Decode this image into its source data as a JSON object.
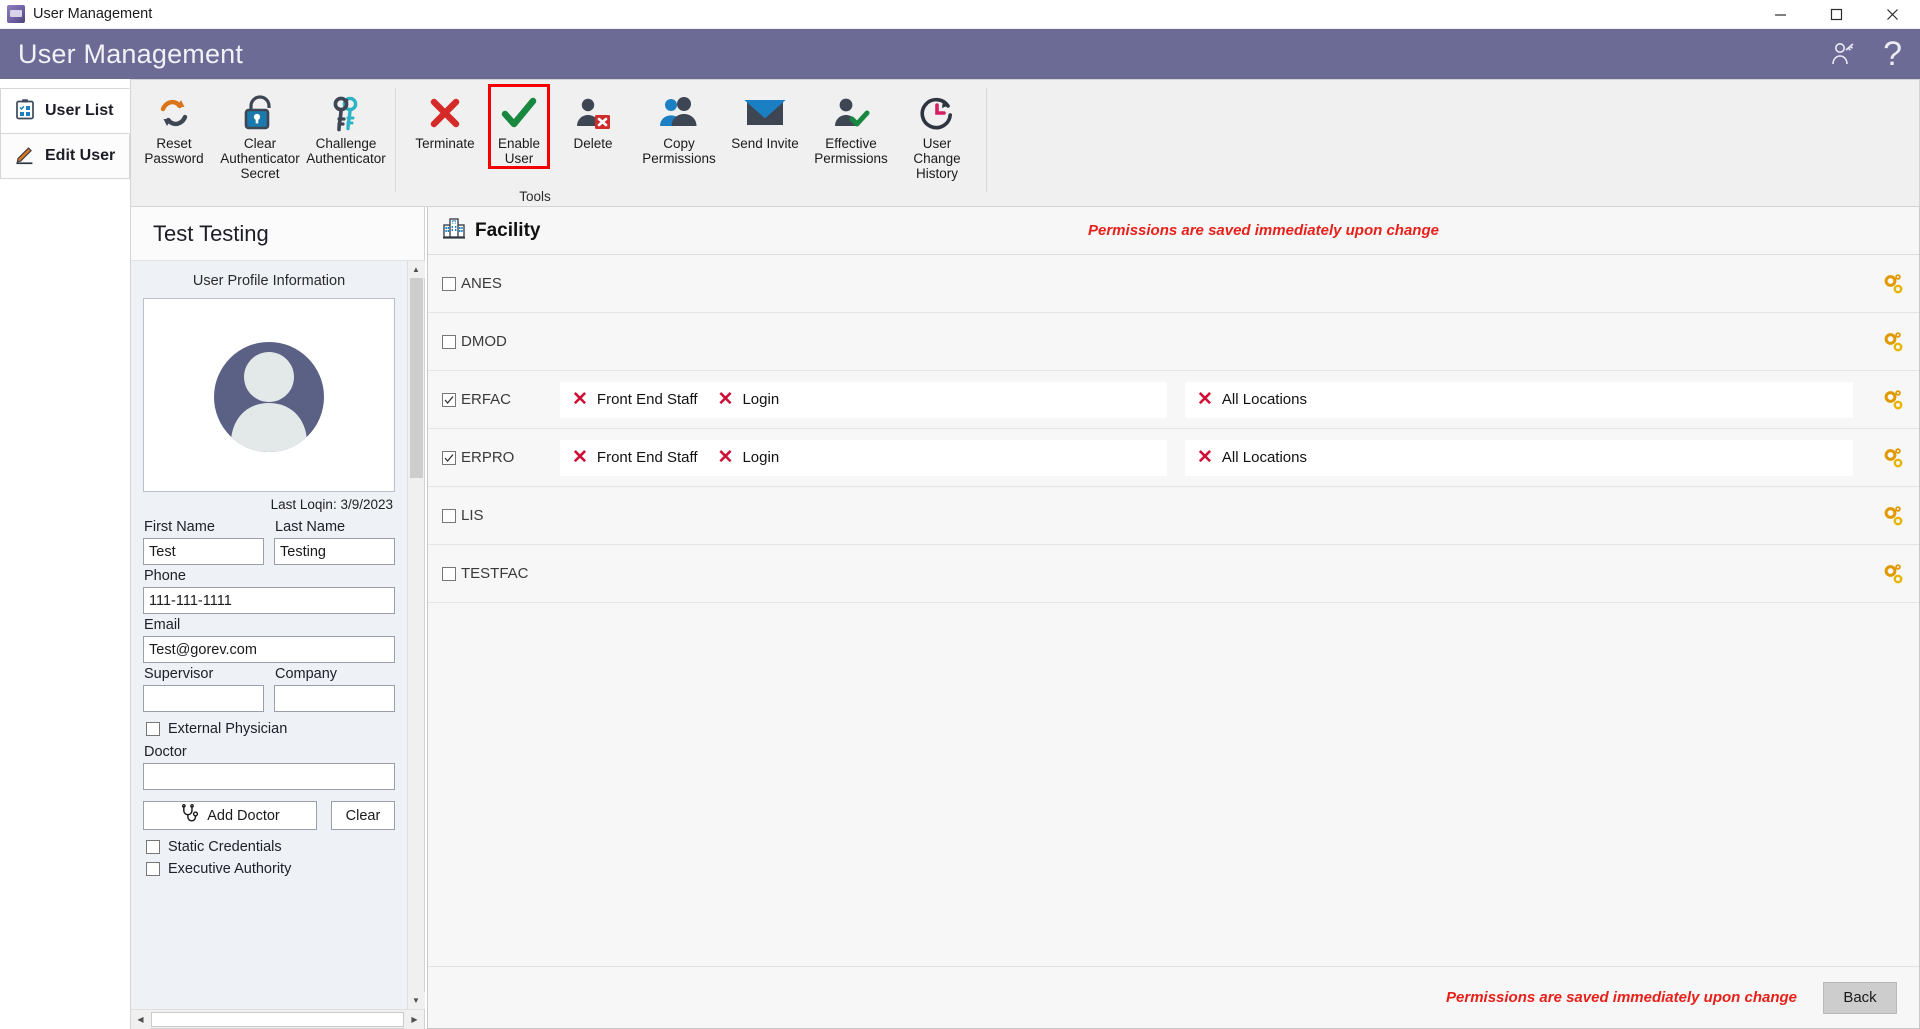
{
  "window": {
    "title": "User Management",
    "app_icon": "app-icon",
    "minimize": "minimize-icon",
    "maximize": "maximize-icon",
    "close": "close-icon"
  },
  "header": {
    "title": "User Management",
    "help_label": "?",
    "accent": "#6b6b96"
  },
  "tabs": [
    {
      "label": "User List",
      "icon": "clipboard-list-icon",
      "active": true
    },
    {
      "label": "Edit User",
      "icon": "pencil-icon",
      "active": false
    }
  ],
  "ribbon": {
    "group_label": "Tools",
    "items": [
      {
        "label": "Reset Password",
        "icon": "reset-password-icon",
        "highlight": false
      },
      {
        "label": "Clear Authenticator Secret",
        "icon": "padlock-icon",
        "highlight": false
      },
      {
        "label": "Challenge Authenticator",
        "icon": "keys-icon",
        "highlight": false
      },
      {
        "label": "Terminate",
        "icon": "red-x-icon",
        "highlight": false
      },
      {
        "label": "Enable User",
        "icon": "green-check-icon",
        "highlight": true
      },
      {
        "label": "Delete",
        "icon": "user-delete-icon",
        "highlight": false
      },
      {
        "label": "Copy Permissions",
        "icon": "two-users-icon",
        "highlight": false
      },
      {
        "label": "Send Invite",
        "icon": "envelope-icon",
        "highlight": false
      },
      {
        "label": "Effective Permissions",
        "icon": "user-check-icon",
        "highlight": false
      },
      {
        "label": "User Change History",
        "icon": "clock-history-icon",
        "highlight": false
      }
    ],
    "highlight_color": "#f40000"
  },
  "profile": {
    "name": "Test Testing",
    "legend": "User Profile Information",
    "avatar": "user-avatar-placeholder",
    "last_login": "Last Loqin: 3/9/2023",
    "fields": {
      "first_name_label": "First Name",
      "first_name_value": "Test",
      "last_name_label": "Last Name",
      "last_name_value": "Testing",
      "phone_label": "Phone",
      "phone_value": "111-111-1111",
      "email_label": "Email",
      "email_value": "Test@gorev.com",
      "supervisor_label": "Supervisor",
      "supervisor_value": "",
      "company_label": "Company",
      "company_value": "",
      "doctor_label": "Doctor",
      "doctor_value": ""
    },
    "checkboxes": [
      {
        "label": "External Physician",
        "checked": false
      },
      {
        "label": "Static Credentials",
        "checked": false
      },
      {
        "label": "Executive Authority",
        "checked": false
      }
    ],
    "buttons": {
      "add_doctor": "Add Doctor",
      "add_doctor_icon": "stethoscope-icon",
      "clear": "Clear"
    }
  },
  "facility": {
    "title": "Facility",
    "icon": "hospital-icon",
    "warning_top": "Permissions are saved immediately upon change",
    "warning_bottom": "Permissions are saved immediately upon change",
    "back_label": "Back",
    "gear_icon": "gears-icon",
    "rows": [
      {
        "name": "ANES",
        "checked": false,
        "roles": [],
        "locations": []
      },
      {
        "name": "DMOD",
        "checked": false,
        "roles": [],
        "locations": []
      },
      {
        "name": "ERFAC",
        "checked": true,
        "roles": [
          "Front End Staff",
          "Login"
        ],
        "locations": [
          "All Locations"
        ]
      },
      {
        "name": "ERPRO",
        "checked": true,
        "roles": [
          "Front End Staff",
          "Login"
        ],
        "locations": [
          "All Locations"
        ]
      },
      {
        "name": "LIS",
        "checked": false,
        "roles": [],
        "locations": []
      },
      {
        "name": "TESTFAC",
        "checked": false,
        "roles": [],
        "locations": []
      }
    ]
  }
}
